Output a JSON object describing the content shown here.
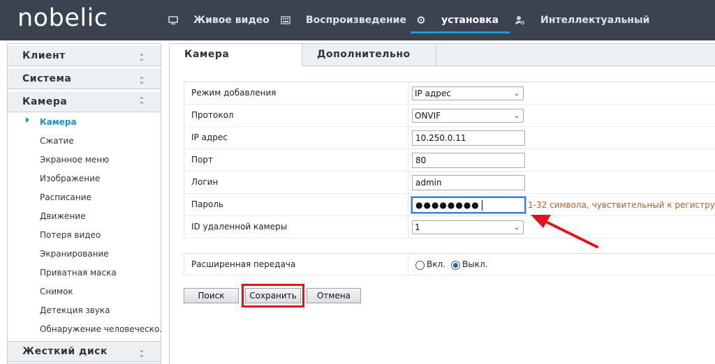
{
  "brand": "nobelic",
  "nav": {
    "items": [
      {
        "label": "Живое видео",
        "icon": "monitor-icon"
      },
      {
        "label": "Воспроизведение",
        "icon": "film-icon"
      },
      {
        "label": "установка",
        "icon": "gear-icon"
      },
      {
        "label": "Интеллектуальный",
        "icon": "user-search-icon"
      }
    ],
    "active_index": 2
  },
  "sidebar": {
    "sections": [
      {
        "label": "Клиент",
        "expanded": false
      },
      {
        "label": "Система",
        "expanded": false
      },
      {
        "label": "Камера",
        "expanded": true
      },
      {
        "label": "Жесткий диск",
        "expanded": false
      }
    ],
    "camera_items": [
      "Камера",
      "Сжатие",
      "Экранное меню",
      "Изображение",
      "Расписание",
      "Движение",
      "Потеря видео",
      "Экранирование",
      "Приватная маска",
      "Снимок",
      "Детекция звука",
      "Обнаружение человеческо..."
    ],
    "active_item": "Камера"
  },
  "tabs": [
    "Камера",
    "Дополнительно"
  ],
  "form": {
    "add_mode_label": "Режим добавления",
    "add_mode_value": "IP адрес",
    "protocol_label": "Протокол",
    "protocol_value": "ONVIF",
    "ip_label": "IP адрес",
    "ip_value": "10.250.0.11",
    "port_label": "Порт",
    "port_value": "80",
    "login_label": "Логин",
    "login_value": "admin",
    "password_label": "Пароль",
    "password_value": "●●●●●●●●",
    "password_hint": "1-32 символа, чувствительный к регистру.",
    "remote_id_label": "ID удаленной камеры",
    "remote_id_value": "1",
    "ext_label": "Расширенная передача",
    "ext_on": "Вкл.",
    "ext_off": "Выкл.",
    "ext_selected": "Выкл."
  },
  "buttons": {
    "search": "Поиск",
    "save": "Сохранить",
    "cancel": "Отмена"
  },
  "colors": {
    "topbar": "#3c4350",
    "accent": "#15a0d8",
    "highlight": "#e0141b",
    "hint": "#b0612a"
  }
}
